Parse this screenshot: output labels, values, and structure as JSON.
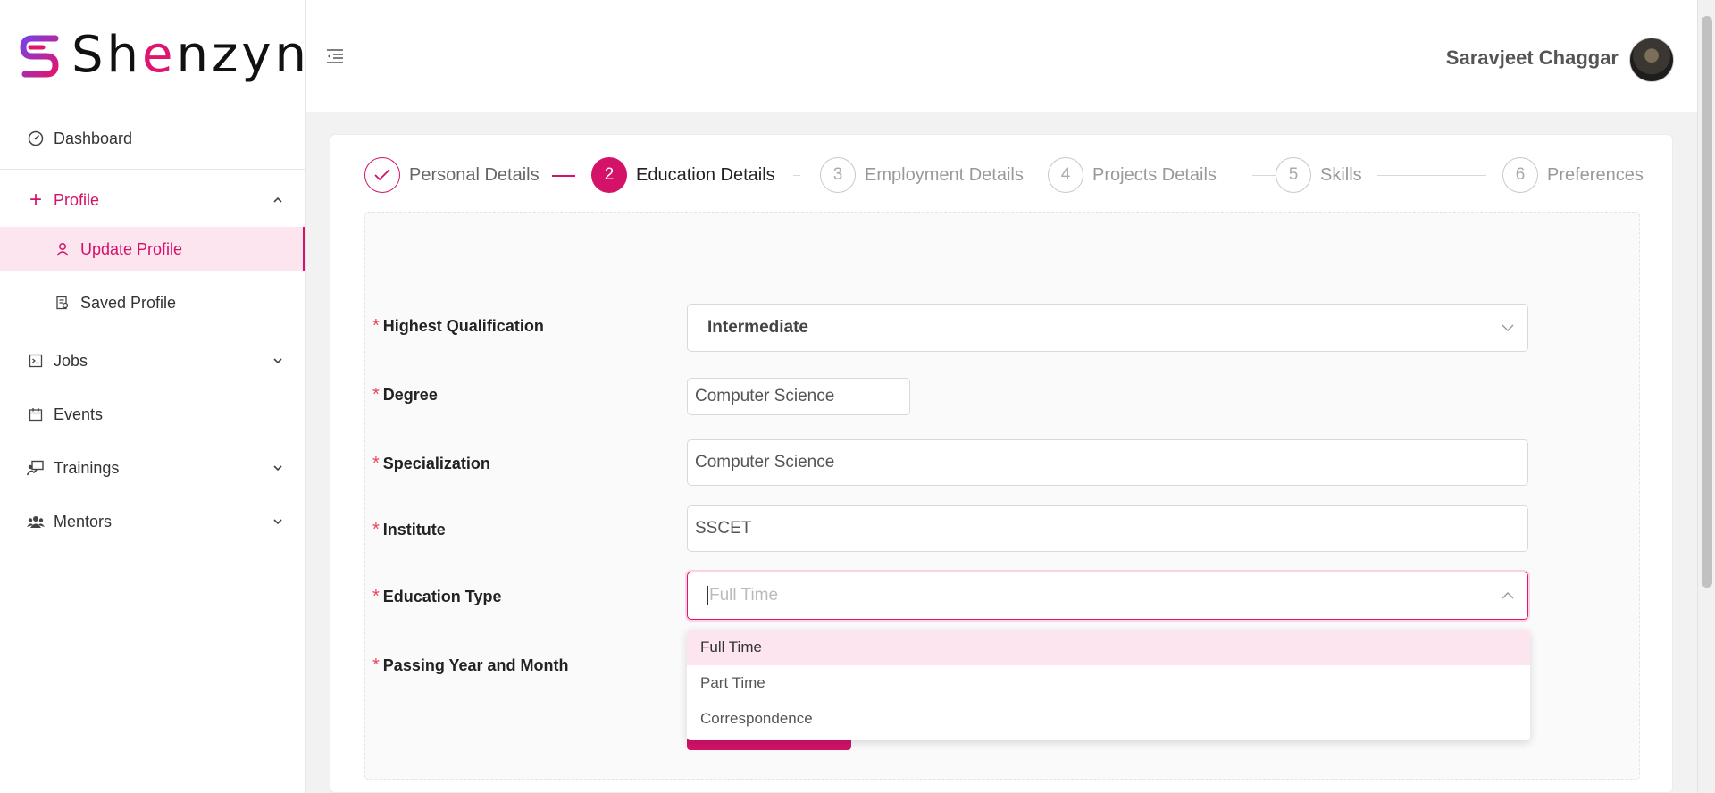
{
  "brand": {
    "name_prefix": "Sh",
    "name_accent": "e",
    "name_suffix": "nzyn",
    "accent_color": "#d31268"
  },
  "sidebar": {
    "items": [
      {
        "label": "Dashboard",
        "icon": "gauge-icon"
      },
      {
        "label": "Profile",
        "icon": "plus-icon",
        "expanded": true
      },
      {
        "label": "Update Profile",
        "icon": "user-icon",
        "active": true
      },
      {
        "label": "Saved Profile",
        "icon": "document-search-icon"
      },
      {
        "label": "Jobs",
        "icon": "terminal-icon"
      },
      {
        "label": "Events",
        "icon": "calendar-icon"
      },
      {
        "label": "Trainings",
        "icon": "presentation-icon"
      },
      {
        "label": "Mentors",
        "icon": "team-icon"
      }
    ]
  },
  "header": {
    "user_name": "Saravjeet Chaggar"
  },
  "steps": [
    {
      "number": "",
      "label": "Personal Details",
      "state": "done"
    },
    {
      "number": "2",
      "label": "Education Details",
      "state": "current"
    },
    {
      "number": "3",
      "label": "Employment Details",
      "state": "pending"
    },
    {
      "number": "4",
      "label": "Projects Details",
      "state": "pending"
    },
    {
      "number": "5",
      "label": "Skills",
      "state": "pending"
    },
    {
      "number": "6",
      "label": "Preferences",
      "state": "pending"
    }
  ],
  "form": {
    "highest_qualification": {
      "label": "Highest Qualification",
      "value": "Intermediate"
    },
    "degree": {
      "label": "Degree",
      "value": "Computer Science"
    },
    "specialization": {
      "label": "Specialization",
      "value": "Computer Science"
    },
    "institute": {
      "label": "Institute",
      "value": "SSCET"
    },
    "education_type": {
      "label": "Education Type",
      "placeholder": "Full Time",
      "options": [
        "Full Time",
        "Part Time",
        "Correspondence"
      ],
      "highlighted": "Full Time"
    },
    "passing_year": {
      "label": "Passing Year and Month"
    }
  }
}
